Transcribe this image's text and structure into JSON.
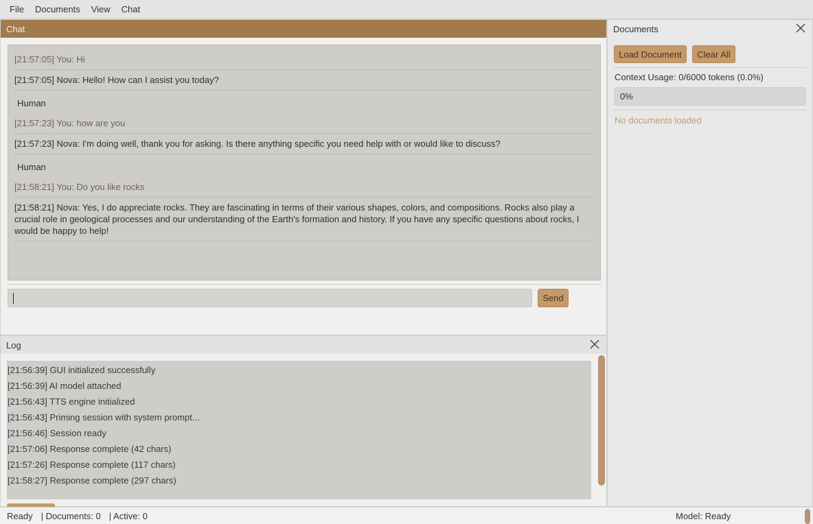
{
  "menu": [
    "File",
    "Documents",
    "View",
    "Chat"
  ],
  "chat": {
    "title": "Chat",
    "messages": [
      {
        "type": "user",
        "text": "[21:57:05] You: Hi"
      },
      {
        "type": "ai",
        "text": "[21:57:05] Nova: Hello! How can I assist you today?"
      },
      {
        "type": "human",
        "text": "Human"
      },
      {
        "type": "user",
        "text": "[21:57:23] You: how are you"
      },
      {
        "type": "ai",
        "text": "[21:57:23] Nova: I'm doing well, thank you for asking. Is there anything specific you need help with or would like to discuss?"
      },
      {
        "type": "human",
        "text": "Human"
      },
      {
        "type": "user",
        "text": "[21:58:21] You: Do you like rocks"
      },
      {
        "type": "ai",
        "text": "[21:58:21] Nova: Yes, I do appreciate rocks. They are fascinating in terms of their various shapes, colors, and compositions. Rocks also play a crucial role in geological processes and our understanding of the Earth's formation and history. If you have any specific questions about rocks, I would be happy to help!"
      }
    ],
    "input_value": "",
    "send_label": "Send"
  },
  "log": {
    "title": "Log",
    "lines": [
      "[21:56:39] GUI initialized successfully",
      "[21:56:39] AI model attached",
      "[21:56:43] TTS engine initialized",
      "[21:56:43] Priming session with system prompt...",
      "[21:56:46] Session ready",
      "[21:57:06] Response complete (42 chars)",
      "[21:57:26] Response complete (117 chars)",
      "[21:58:27] Response complete (297 chars)"
    ]
  },
  "documents": {
    "title": "Documents",
    "load_label": "Load Document",
    "clear_label": "Clear All",
    "context_usage": "Context Usage: 0/6000 tokens (0.0%)",
    "progress_text": "0%",
    "progress_value": 0,
    "empty_text": "No documents loaded"
  },
  "status": {
    "ready": "Ready",
    "documents": "| Documents: 0",
    "active": "| Active: 0",
    "model": "Model: Ready"
  },
  "colors": {
    "accent": "#c49a6a",
    "title_bar": "#a27a4c",
    "muted_text": "#c39b6e"
  }
}
